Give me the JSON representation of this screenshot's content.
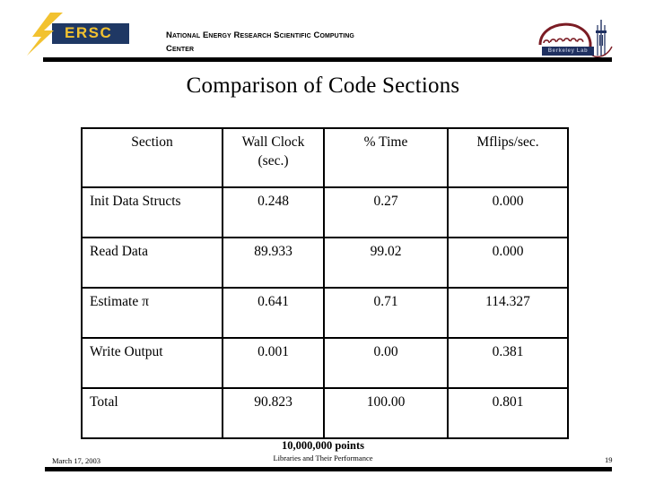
{
  "header": {
    "org_line1": "National Energy Research Scientific Computing",
    "org_line2": "Center",
    "nersc_logo_text": "ERSC",
    "berkeley_logo_text": "Berkeley Lab",
    "colors": {
      "nersc_navy": "#1f3864",
      "nersc_gold": "#f2c230",
      "berkeley_navy": "#1f3060",
      "berkeley_dome": "#7b1c24",
      "rule": "#000000"
    }
  },
  "slide": {
    "title": "Comparison of Code Sections"
  },
  "table": {
    "columns": [
      "Section",
      "Wall Clock (sec.)",
      "% Time",
      "Mflips/sec."
    ],
    "header_cells": [
      {
        "line1": "Section",
        "line2": ""
      },
      {
        "line1": "Wall Clock",
        "line2": "(sec.)"
      },
      {
        "line1": "% Time",
        "line2": ""
      },
      {
        "line1": "Mflips/sec.",
        "line2": ""
      }
    ],
    "rows": [
      {
        "section": "Init Data Structs",
        "wall_clock": "0.248",
        "pct_time": "0.27",
        "mflips": "0.000",
        "highlight": false
      },
      {
        "section": "Read Data",
        "wall_clock": "89.933",
        "pct_time": "99.02",
        "mflips": "0.000",
        "highlight": true
      },
      {
        "section": "Estimate π",
        "wall_clock": "0.641",
        "pct_time": "0.71",
        "mflips": "114.327",
        "highlight": false
      },
      {
        "section": "Write Output",
        "wall_clock": "0.001",
        "pct_time": "0.00",
        "mflips": "0.381",
        "highlight": false
      },
      {
        "section": "Total",
        "wall_clock": "90.823",
        "pct_time": "100.00",
        "mflips": "0.801",
        "highlight": false
      }
    ],
    "highlight_color": "#1d7a3c"
  },
  "footer": {
    "points_note": "10,000,000 points",
    "subtitle": "Libraries and Their Performance",
    "date": "March 17, 2003",
    "page_number": "19"
  }
}
